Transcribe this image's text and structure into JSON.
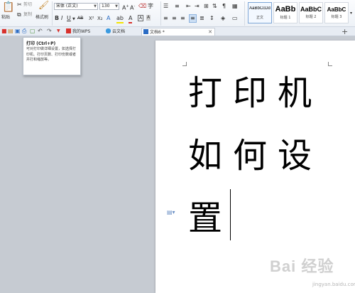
{
  "ribbon": {
    "paste_label": "粘贴",
    "cut_label": "剪切",
    "copy_label": "复制",
    "format_painter_label": "格式刷",
    "font_name": "宋体 (正文)",
    "font_size": "130",
    "styles": [
      {
        "sample": "AaBbCcDd",
        "name": "正文"
      },
      {
        "sample": "AaBb",
        "name": "标题 1"
      },
      {
        "sample": "AaBbC",
        "name": "标题 2"
      },
      {
        "sample": "AaBbC",
        "name": "标题 3"
      }
    ]
  },
  "tabs": [
    {
      "label": "我的WPS"
    },
    {
      "label": "云文档"
    },
    {
      "label": "文档6 *"
    }
  ],
  "tooltip": {
    "title": "打印 (Ctrl+P)",
    "description": "可对打印做详细设置，如选择打印机、打印页数、打印份数或者并打和缩放等。"
  },
  "document": {
    "lines": [
      "打印机",
      "如何设",
      "置"
    ]
  },
  "watermark": {
    "text": "Bai 经验",
    "url": "jingyan.baidu.com"
  },
  "colors": {
    "accent": "#2b6cc4",
    "wps_red": "#d8312c",
    "workspace": "#c6cbd2"
  }
}
